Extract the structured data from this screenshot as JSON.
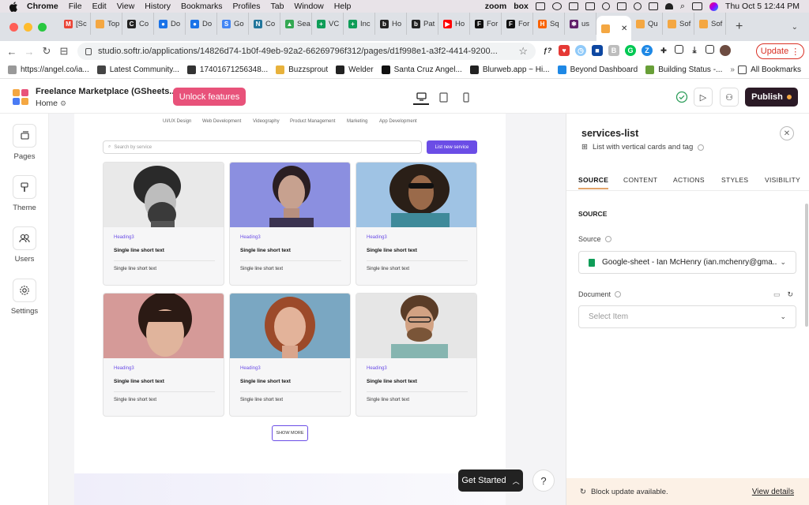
{
  "menubar": {
    "app": "Chrome",
    "items": [
      "File",
      "Edit",
      "View",
      "History",
      "Bookmarks",
      "Profiles",
      "Tab",
      "Window",
      "Help"
    ],
    "status": [
      "zoom",
      "box"
    ],
    "datetime": "Thu Oct 5  12:44 PM"
  },
  "tabs": [
    {
      "label": "[Sc",
      "icon": "gmail-icon",
      "color": "#ea4335",
      "glyph": "M"
    },
    {
      "label": "Top",
      "icon": "softr-icon",
      "color": "#f4a742",
      "glyph": ""
    },
    {
      "label": "Co",
      "icon": "c-icon",
      "color": "#222",
      "glyph": "C"
    },
    {
      "label": "Do",
      "icon": "doc-icon",
      "color": "#1a73e8",
      "glyph": "●"
    },
    {
      "label": "Do",
      "icon": "doc-icon",
      "color": "#1a73e8",
      "glyph": "●"
    },
    {
      "label": "Go",
      "icon": "google-sites-icon",
      "color": "#4285f4",
      "glyph": "S"
    },
    {
      "label": "Co",
      "icon": "wordpress-icon",
      "color": "#21759b",
      "glyph": "N"
    },
    {
      "label": "Sea",
      "icon": "drive-icon",
      "color": "#34a853",
      "glyph": "▲"
    },
    {
      "label": "VC",
      "icon": "sheets-icon",
      "color": "#0f9d58",
      "glyph": "+"
    },
    {
      "label": "Inc",
      "icon": "sheets-icon",
      "color": "#0f9d58",
      "glyph": "+"
    },
    {
      "label": "Ho",
      "icon": "b-icon",
      "color": "#222",
      "glyph": "b"
    },
    {
      "label": "Pat",
      "icon": "b-icon",
      "color": "#222",
      "glyph": "b"
    },
    {
      "label": "Ho",
      "icon": "youtube-icon",
      "color": "#ff0000",
      "glyph": "▶"
    },
    {
      "label": "For",
      "icon": "f-icon",
      "color": "#111",
      "glyph": "F"
    },
    {
      "label": "For",
      "icon": "f-icon",
      "color": "#111",
      "glyph": "F"
    },
    {
      "label": "Sq",
      "icon": "homedepot-icon",
      "color": "#f96302",
      "glyph": "H"
    },
    {
      "label": "us",
      "icon": "slack-icon",
      "color": "#611f69",
      "glyph": "✱"
    },
    {
      "label": "",
      "icon": "softr-icon",
      "color": "#f4a742",
      "glyph": "",
      "active": true
    },
    {
      "label": "Qu",
      "icon": "softr-icon",
      "color": "#f4a742",
      "glyph": ""
    },
    {
      "label": "Sof",
      "icon": "softr-icon",
      "color": "#f4a742",
      "glyph": ""
    },
    {
      "label": "Sof",
      "icon": "softr-icon",
      "color": "#f4a742",
      "glyph": ""
    }
  ],
  "address": {
    "url": "studio.softr.io/applications/14826d74-1b0f-49eb-92a2-66269796f312/pages/d1f998e1-a3f2-4414-9200...",
    "update_label": "Update"
  },
  "bookmarks": [
    {
      "label": "https://angel.co/ia...",
      "color": "#999"
    },
    {
      "label": "Latest Community...",
      "color": "#444"
    },
    {
      "label": "17401671256348...",
      "color": "#333"
    },
    {
      "label": "Buzzsprout",
      "color": "#e8b23c"
    },
    {
      "label": "Welder",
      "color": "#222"
    },
    {
      "label": "Santa Cruz Angel...",
      "color": "#111"
    },
    {
      "label": "Blurweb.app ~ Hi...",
      "color": "#222"
    },
    {
      "label": "Beyond Dashboard",
      "color": "#1e88e5"
    },
    {
      "label": "Building Status -...",
      "color": "#689f38"
    }
  ],
  "bookmarks_all": "All Bookmarks",
  "app": {
    "site_name": "Freelance Marketplace (GSheets...",
    "page_name": "Home",
    "unlock_label": "Unlock features",
    "publish_label": "Publish"
  },
  "leftbar": [
    {
      "label": "Pages",
      "icon": "pages-icon"
    },
    {
      "label": "Theme",
      "icon": "theme-icon"
    },
    {
      "label": "Users",
      "icon": "users-icon"
    },
    {
      "label": "Settings",
      "icon": "settings-icon"
    }
  ],
  "canvas": {
    "categories": [
      "UI/UX Design",
      "Web Development",
      "Videography",
      "Product Management",
      "Marketing",
      "App Development"
    ],
    "search_placeholder": "Search by service",
    "list_new_label": "List new service",
    "cards": [
      {
        "heading": "Heading3",
        "title": "Single line short text",
        "text": "Single line short text",
        "photo": "bearded-man-curly-hair-photo"
      },
      {
        "heading": "Heading3",
        "title": "Single line short text",
        "text": "Single line short text",
        "photo": "woman-blue-light-photo"
      },
      {
        "heading": "Heading3",
        "title": "Single line short text",
        "text": "Single line short text",
        "photo": "man-sunglasses-photo"
      },
      {
        "heading": "Heading3",
        "title": "Single line short text",
        "text": "Single line short text",
        "photo": "woman-bangs-photo"
      },
      {
        "heading": "Heading3",
        "title": "Single line short text",
        "text": "Single line short text",
        "photo": "woman-red-hair-photo"
      },
      {
        "heading": "Heading3",
        "title": "Single line short text",
        "text": "Single line short text",
        "photo": "man-glasses-smiling-photo"
      }
    ],
    "show_more_label": "SHOW MORE",
    "get_started_label": "Get Started",
    "help_label": "?"
  },
  "panel": {
    "title": "services-list",
    "subtitle": "List with vertical cards and tag",
    "tabs": [
      "SOURCE",
      "CONTENT",
      "ACTIONS",
      "STYLES",
      "VISIBILITY"
    ],
    "active_tab": "SOURCE",
    "section_heading": "SOURCE",
    "source_label": "Source",
    "source_value": "Google-sheet - Ian McHenry (ian.mchenry@gma...",
    "document_label": "Document",
    "document_placeholder": "Select Item",
    "update_message": "Block update available.",
    "update_link": "View details"
  },
  "colors": {
    "accent": "#6b4de6",
    "unlock": "#e8527a",
    "publish": "#2b1a26",
    "tab_underline": "#e2a36a"
  }
}
